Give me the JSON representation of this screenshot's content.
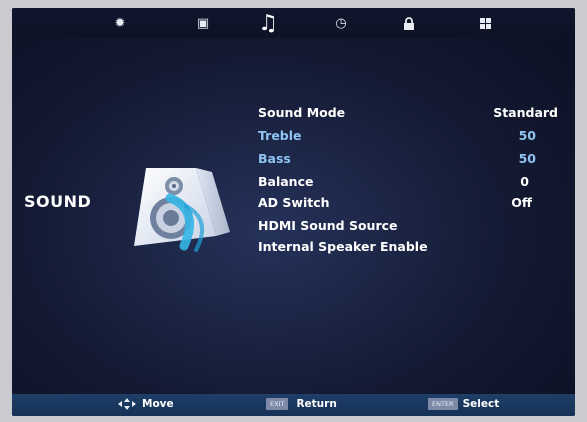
{
  "tabs": [
    {
      "icon": "gear-icon",
      "glyph": "✹"
    },
    {
      "icon": "monitor-icon",
      "glyph": "▣"
    },
    {
      "icon": "music-note-icon",
      "glyph": "♫"
    },
    {
      "icon": "clock-icon",
      "glyph": "◷"
    },
    {
      "icon": "lock-icon",
      "glyph": "🔒"
    },
    {
      "icon": "grid-icon",
      "glyph": "▦"
    }
  ],
  "page_title": "SOUND",
  "menu": [
    {
      "label": "Sound Mode",
      "value": "Standard"
    },
    {
      "label": "Treble",
      "value": "50"
    },
    {
      "label": "Bass",
      "value": "50"
    },
    {
      "label": "Balance",
      "value": "0"
    },
    {
      "label": "AD Switch",
      "value": "Off"
    },
    {
      "label": "HDMI Sound Source",
      "value": ""
    },
    {
      "label": "Internal Speaker Enable",
      "value": ""
    }
  ],
  "footer": {
    "move_label": "Move",
    "exit_key": "EXIT",
    "return_label": "Return",
    "enter_key": "ENTER",
    "select_label": "Select"
  },
  "colors": {
    "highlight": "#8fc4f2",
    "text": "#ffffff",
    "footer_bg": "#1f3f68"
  }
}
